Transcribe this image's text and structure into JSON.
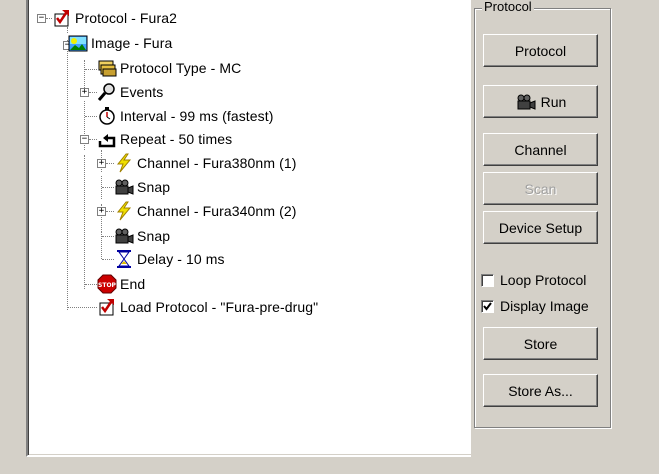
{
  "tree": {
    "items": [
      {
        "label": "Protocol - Fura2",
        "icon": "protocol-icon",
        "expander": "−"
      },
      {
        "label": "Image - Fura",
        "icon": "image-icon",
        "expander": "−"
      },
      {
        "label": "Protocol Type - MC",
        "icon": "protocol-type-icon"
      },
      {
        "label": "Events",
        "icon": "events-magnifier-icon",
        "expander": "+"
      },
      {
        "label": "Interval - 99 ms (fastest)",
        "icon": "stopwatch-icon"
      },
      {
        "label": "Repeat - 50 times",
        "icon": "repeat-icon",
        "expander": "−"
      },
      {
        "label": "Channel - Fura380nm (1)",
        "icon": "lightning-icon",
        "expander": "+"
      },
      {
        "label": "Snap",
        "icon": "camera-icon"
      },
      {
        "label": "Channel - Fura340nm (2)",
        "icon": "lightning-icon",
        "expander": "+"
      },
      {
        "label": "Snap",
        "icon": "camera-icon"
      },
      {
        "label": "Delay - 10 ms",
        "icon": "hourglass-icon"
      },
      {
        "label": "End",
        "icon": "stop-sign-icon"
      },
      {
        "label": "Load Protocol - \"Fura-pre-drug\"",
        "icon": "load-protocol-icon"
      }
    ]
  },
  "panel": {
    "title": "Protocol",
    "buttons": {
      "protocol": "Protocol",
      "run": "Run",
      "channel": "Channel",
      "scan": "Scan",
      "device_setup": "Device Setup",
      "store": "Store",
      "store_as": "Store As..."
    },
    "checkboxes": {
      "loop_protocol": {
        "label": "Loop Protocol",
        "checked": false
      },
      "display_image": {
        "label": "Display Image",
        "checked": true
      }
    }
  },
  "colors": {
    "window_bg": "#d4d0c8",
    "tree_bg": "#ffffff",
    "disabled_text": "#a0a0a0",
    "lightning": "#f0e000",
    "stop_red": "#cc0000"
  }
}
